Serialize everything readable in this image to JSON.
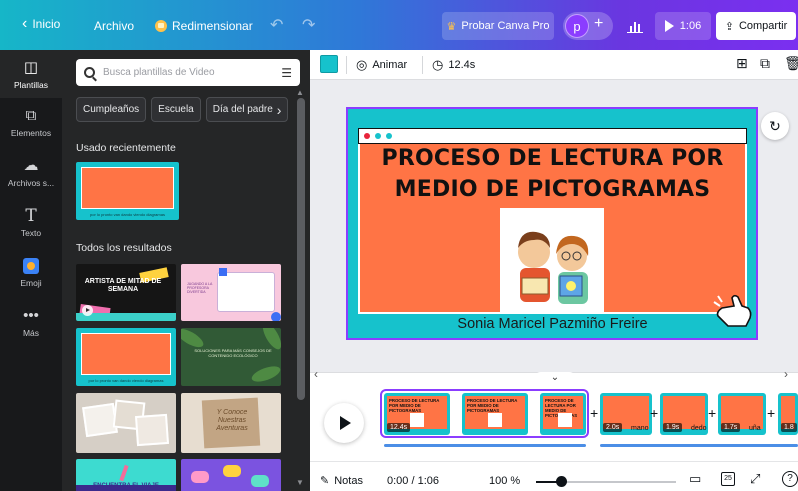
{
  "topbar": {
    "home_label": "Inicio",
    "file_label": "Archivo",
    "resize_label": "Redimensionar",
    "pro_label": "Probar Canva Pro",
    "avatar_initial": "p",
    "play_duration": "1:06",
    "share_label": "Compartir"
  },
  "rail": {
    "items": [
      {
        "label": "Plantillas",
        "icon": "template-icon"
      },
      {
        "label": "Elementos",
        "icon": "elements-icon"
      },
      {
        "label": "Archivos s...",
        "icon": "cloud-upload-icon"
      },
      {
        "label": "Texto",
        "icon": "text-icon"
      },
      {
        "label": "Emoji",
        "icon": "emoji-icon"
      },
      {
        "label": "Más",
        "icon": "more-icon"
      }
    ]
  },
  "panel": {
    "search_placeholder": "Busca plantillas de Video",
    "chips": [
      "Cumpleaños",
      "Escuela",
      "Día del padre"
    ],
    "recent_title": "Usado recientemente",
    "results_title": "Todos los resultados",
    "thumbnails": {
      "recent_caption": "por lo pronto van dando viendo diagramas",
      "artista_title": "ARTISTA DE MITAD DE SEMANA",
      "pink_caption": "JUGANDO A LA PROFESORA DIVERTIDA",
      "green_caption": "SOLUCIONES PARA MÁS CONSEJOS DE CONTENIDO ECOLÓGICO",
      "paper_caption": "Y Conoce Nuestras Aventuras",
      "aqua_caption": "ENCUENTRA EL VIAJE"
    }
  },
  "editor_toolbar": {
    "animate_label": "Animar",
    "duration_label": "12.4s",
    "bg_color": "#16c2cc"
  },
  "slide": {
    "title_line1": "PROCESO DE LECTURA POR",
    "title_line2": "MEDIO DE PICTOGRAMAS",
    "subtitle": "Sonia Maricel Pazmiño Freire",
    "colors": {
      "frame": "#16c2cc",
      "card": "#ff7445",
      "dot_red": "#e8243b",
      "dot_teal": "#16c2cc",
      "dot_teal2": "#16c2cc"
    }
  },
  "timeline": {
    "clips": [
      {
        "duration": "12.4s",
        "label": "",
        "title": "PROCESO DE LECTURA POR MEDIO DE PICTOGRAMAS"
      },
      {
        "duration": "",
        "label": "",
        "title": "PROCESO DE LECTURA POR MEDIO DE PICTOGRAMAS"
      },
      {
        "duration": "",
        "label": "",
        "title": "PROCESO DE LECTURA POR MEDIO DE PICTOGRAMAS"
      },
      {
        "duration": "2.0s",
        "label": "mano",
        "title": ""
      },
      {
        "duration": "1.9s",
        "label": "dedo",
        "title": ""
      },
      {
        "duration": "1.7s",
        "label": "uña",
        "title": ""
      },
      {
        "duration": "1.8",
        "label": "",
        "title": ""
      }
    ]
  },
  "bottombar": {
    "notes_label": "Notas",
    "time": "0:00 / 1:06",
    "zoom": "100 %",
    "zoom_fraction": 0.18,
    "page_count": "25",
    "help": "?"
  }
}
